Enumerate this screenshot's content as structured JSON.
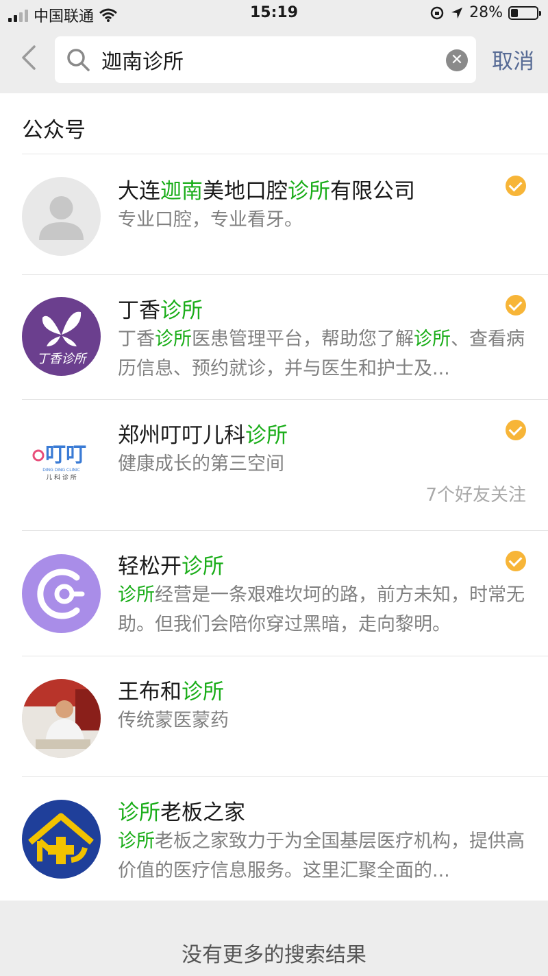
{
  "status_bar": {
    "carrier": "中国联通",
    "time": "15:19",
    "battery": "28%",
    "battery_level": 0.28
  },
  "search": {
    "query": "迦南诊所",
    "cancel_label": "取消"
  },
  "section_title": "公众号",
  "accounts": [
    {
      "title_parts": [
        [
          "大连",
          false
        ],
        [
          "迦南",
          true
        ],
        [
          "美地口腔",
          false
        ],
        [
          "诊所",
          true
        ],
        [
          "有限公司",
          false
        ]
      ],
      "desc_parts": [
        [
          "专业口腔，专业看牙。",
          false
        ]
      ],
      "verified": true
    },
    {
      "title_parts": [
        [
          "丁香",
          false
        ],
        [
          "诊所",
          true
        ]
      ],
      "desc_parts": [
        [
          "丁香",
          false
        ],
        [
          "诊所",
          true
        ],
        [
          "医患管理平台，帮助您了解",
          false
        ],
        [
          "诊所",
          true
        ],
        [
          "、查看病历信息、预约就诊，并与医生和护士及...",
          false
        ]
      ],
      "verified": true,
      "logo_text": "丁香诊所"
    },
    {
      "title_parts": [
        [
          "郑州叮叮儿科",
          false
        ],
        [
          "诊所",
          true
        ]
      ],
      "desc_parts": [
        [
          "健康成长的第三空间",
          false
        ]
      ],
      "verified": true,
      "follow_text": "7个好友关注",
      "logo_text": "叮叮",
      "logo_sub": "DING DING CLINIC",
      "logo_sub2": "儿 科 诊 所"
    },
    {
      "title_parts": [
        [
          "轻松开",
          false
        ],
        [
          "诊所",
          true
        ]
      ],
      "desc_parts": [
        [
          "诊所",
          true
        ],
        [
          "经营是一条艰难坎坷的路，前方未知，时常无助。但我们会陪你穿过黑暗，走向黎明。",
          false
        ]
      ],
      "verified": true
    },
    {
      "title_parts": [
        [
          "王布和",
          false
        ],
        [
          "诊所",
          true
        ]
      ],
      "desc_parts": [
        [
          "传统蒙医蒙药",
          false
        ]
      ],
      "verified": false
    },
    {
      "title_parts": [
        [
          "诊所",
          true
        ],
        [
          "老板之家",
          false
        ]
      ],
      "desc_parts": [
        [
          "诊所",
          true
        ],
        [
          "老板之家致力于为全国基层医疗机构，提供高价值的医疗信息服务。这里汇聚全面的...",
          false
        ]
      ],
      "verified": false
    }
  ],
  "footer_text": "没有更多的搜索结果",
  "colors": {
    "highlight": "#1aad19",
    "link": "#576b95",
    "verified": "#f7b538",
    "dingxiang_purple": "#6b3f8e",
    "qingsong_purple": "#a98de8",
    "laoban_blue": "#1f3f9a",
    "laoban_yellow": "#f2c200"
  }
}
